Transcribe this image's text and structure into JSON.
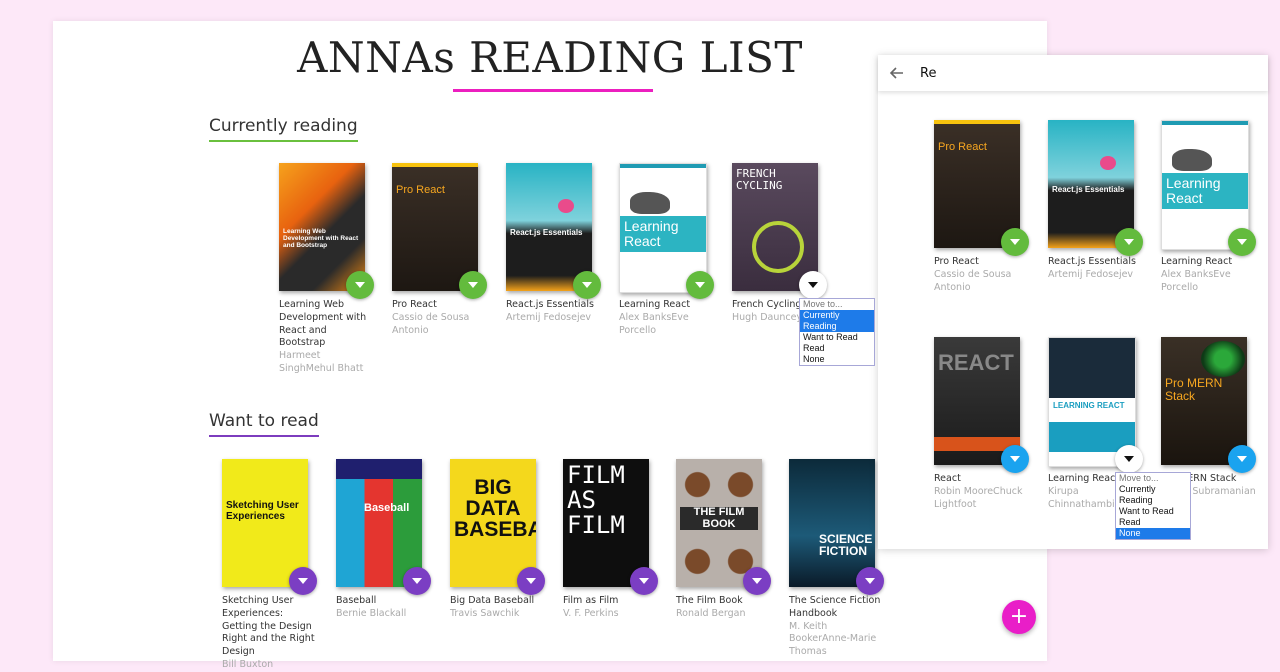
{
  "main": {
    "title": "ANNAs READING LIST",
    "shelves": [
      {
        "name": "Currently reading",
        "books": [
          {
            "title": "Learning Web Development with React and Bootstrap",
            "author": "Harmeet SinghMehul Bhatt",
            "cover_text": "Learning Web Development with React and Bootstrap"
          },
          {
            "title": "Pro React",
            "author": "Cassio de Sousa Antonio",
            "cover_text": "Pro React"
          },
          {
            "title": "React.js Essentials",
            "author": "Artemij Fedosejev",
            "cover_text": "React.js Essentials"
          },
          {
            "title": "Learning React",
            "author": "Alex BanksEve Porcello",
            "cover_text": "Learning React"
          },
          {
            "title": "French Cycling",
            "author": "Hugh Dauncey",
            "cover_text": "FRENCH CYCLING"
          }
        ],
        "dropdown": {
          "header": "Move to...",
          "options": [
            "Currently Reading",
            "Want to Read",
            "Read",
            "None"
          ],
          "selected": "Currently Reading"
        }
      },
      {
        "name": "Want to read",
        "books": [
          {
            "title": "Sketching User Experiences: Getting the Design Right and the Right Design",
            "author": "Bill Buxton",
            "cover_text": "Sketching User Experiences"
          },
          {
            "title": "Baseball",
            "author": "Bernie Blackall",
            "cover_text": "Baseball"
          },
          {
            "title": "Big Data Baseball",
            "author": "Travis Sawchik",
            "cover_text": "BIG DATA BASEBALL"
          },
          {
            "title": "Film as Film",
            "author": "V. F. Perkins",
            "cover_text": "FILM AS FILM"
          },
          {
            "title": "The Film Book",
            "author": "Ronald Bergan",
            "cover_text": "THE FILM BOOK"
          },
          {
            "title": "The Science Fiction Handbook",
            "author": "M. Keith BookerAnne-Marie Thomas",
            "cover_text": "SCIENCE FICTION"
          }
        ]
      }
    ]
  },
  "search": {
    "query": "Re",
    "results": [
      {
        "title": "Pro React",
        "author": "Cassio de Sousa Antonio",
        "cover_text": "Pro React"
      },
      {
        "title": "React.js Essentials",
        "author": "Artemij Fedosejev",
        "cover_text": "React.js Essentials"
      },
      {
        "title": "Learning React",
        "author": "Alex BanksEve Porcello",
        "cover_text": "Learning React"
      },
      {
        "title": "React",
        "author": "Robin MooreChuck Lightfoot",
        "cover_text": "REACT"
      },
      {
        "title": "Learning React",
        "author": "Kirupa Chinnathambi",
        "cover_text": "LEARNING REACT"
      },
      {
        "title": "Pro MERN Stack",
        "author": "Vasan Subramanian",
        "cover_text": "Pro MERN Stack"
      }
    ],
    "dropdown": {
      "header": "Move to...",
      "options": [
        "Currently Reading",
        "Want to Read",
        "Read",
        "None"
      ],
      "selected": "None"
    }
  },
  "add_button": "+",
  "colors": {
    "accent": "#ec1fbf",
    "current": "#63bb3d",
    "want": "#7b3ec3",
    "none": "#1aa3ef"
  }
}
